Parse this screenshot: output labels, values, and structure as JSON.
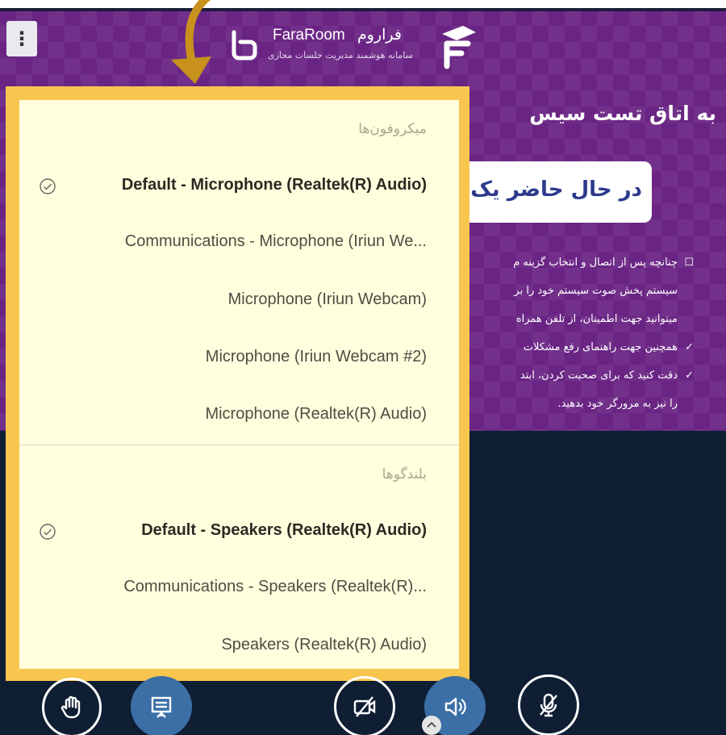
{
  "app": {
    "name_en": "FaraRoom",
    "name_fa": "فراروم",
    "subtitle": "سامانه هوشمند مدیریت جلسات مجازی"
  },
  "page": {
    "welcome": "به اتاق تست سیس",
    "status": "در حال حاضر یک مو",
    "notes": [
      "چنانچه پس از اتصال و انتخاب گزینه م",
      "سیستم پخش صوت سیستم خود را بر",
      "میتوانید جهت اطمینان، از تلفن همراه",
      "همچنین جهت راهنمای رفع مشکلات",
      "دقت کنید که برای صحبت کردن، ابتد",
      "را نیز به مرورگر خود بدهید."
    ]
  },
  "audio_menu": {
    "microphones_title": "میکروفون‌ها",
    "microphones": [
      {
        "label": "Default - Microphone (Realtek(R) Audio)",
        "selected": true
      },
      {
        "label": "Communications - Microphone (Iriun We...",
        "selected": false
      },
      {
        "label": "Microphone (Iriun Webcam)",
        "selected": false
      },
      {
        "label": "Microphone (Iriun Webcam #2)",
        "selected": false
      },
      {
        "label": "Microphone (Realtek(R) Audio)",
        "selected": false
      }
    ],
    "speakers_title": "بلندگوها",
    "speakers": [
      {
        "label": "Default - Speakers (Realtek(R) Audio)",
        "selected": true
      },
      {
        "label": "Communications - Speakers (Realtek(R)...",
        "selected": false
      },
      {
        "label": "Speakers (Realtek(R) Audio)",
        "selected": false
      }
    ]
  },
  "toolbar": {
    "buttons": [
      {
        "icon": "raise-hand-icon"
      },
      {
        "icon": "presentation-icon"
      },
      {
        "icon": "camera-off-icon"
      },
      {
        "icon": "speaker-icon"
      },
      {
        "icon": "mic-muted-icon"
      }
    ]
  },
  "colors": {
    "banner": "#6a2584",
    "popup_bg": "#ffffde",
    "popup_frame": "#f8c54f",
    "bottom": "#0f1e33",
    "toolbar_active": "#3b6fa6"
  }
}
